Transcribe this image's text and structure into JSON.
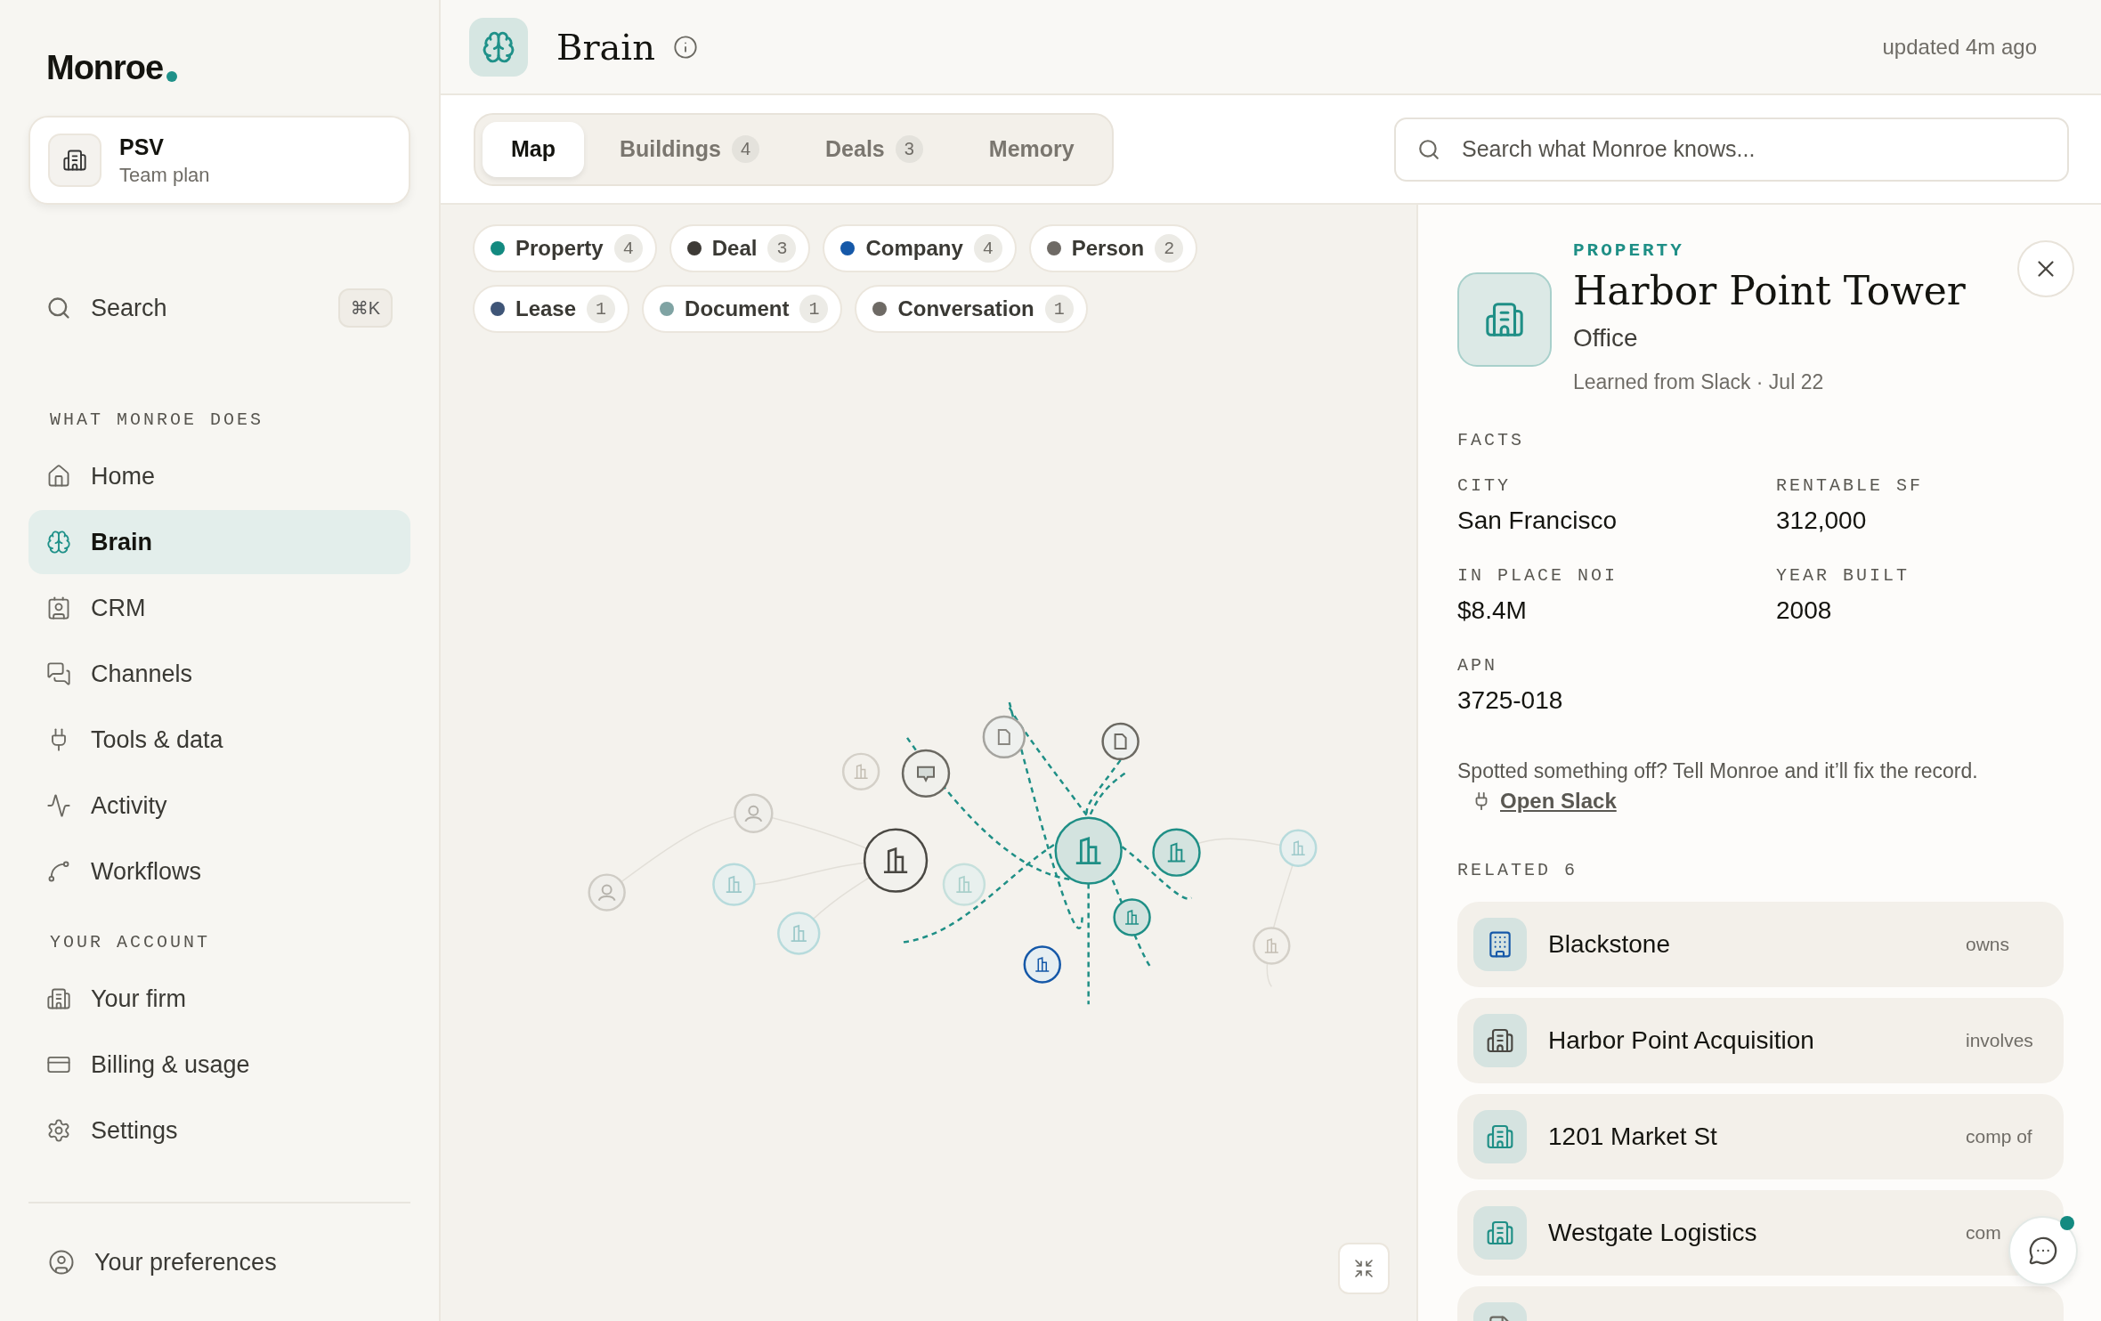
{
  "sidebar": {
    "logo": "Monroe",
    "workspace": {
      "name": "PSV",
      "plan": "Team plan"
    },
    "search": {
      "label": "Search",
      "shortcut": "⌘K"
    },
    "sections": [
      {
        "title": "WHAT MONROE DOES",
        "items": [
          {
            "label": "Home",
            "selected": false
          },
          {
            "label": "Brain",
            "selected": true
          },
          {
            "label": "CRM",
            "selected": false
          },
          {
            "label": "Channels",
            "selected": false
          },
          {
            "label": "Tools & data",
            "selected": false
          },
          {
            "label": "Activity",
            "selected": false
          },
          {
            "label": "Workflows",
            "selected": false
          }
        ]
      },
      {
        "title": "YOUR ACCOUNT",
        "items": [
          {
            "label": "Your firm",
            "selected": false
          },
          {
            "label": "Billing & usage",
            "selected": false
          },
          {
            "label": "Settings",
            "selected": false
          }
        ]
      }
    ],
    "footer": "Your preferences"
  },
  "header": {
    "title": "Brain",
    "updated": "updated 4m ago"
  },
  "tabs": [
    {
      "label": "Map",
      "selected": true
    },
    {
      "label": "Buildings",
      "count": "4",
      "selected": false
    },
    {
      "label": "Deals",
      "count": "3",
      "selected": false
    },
    {
      "label": "Memory",
      "selected": false
    }
  ],
  "search": {
    "placeholder": "Search what Monroe knows..."
  },
  "filters": [
    {
      "label": "Property",
      "count": "4",
      "color": "#138a80"
    },
    {
      "label": "Deal",
      "count": "3",
      "color": "#3d3a36"
    },
    {
      "label": "Company",
      "count": "4",
      "color": "#1558a8"
    },
    {
      "label": "Person",
      "count": "2",
      "color": "#6e6a65"
    },
    {
      "label": "Lease",
      "count": "1",
      "color": "#3f5577"
    },
    {
      "label": "Document",
      "count": "1",
      "color": "#7fa3a3"
    },
    {
      "label": "Conversation",
      "count": "1",
      "color": "#6e6a65"
    }
  ],
  "detail": {
    "type": "PROPERTY",
    "title": "Harbor Point Tower",
    "subtitle": "Office",
    "source": "Learned from Slack · Jul 22",
    "facts_title": "FACTS",
    "facts": [
      {
        "label": "CITY",
        "value": "San Francisco"
      },
      {
        "label": "RENTABLE SF",
        "value": "312,000"
      },
      {
        "label": "IN PLACE NOI",
        "value": "$8.4M"
      },
      {
        "label": "YEAR BUILT",
        "value": "2008"
      },
      {
        "label": "APN",
        "value": "3725-018"
      }
    ],
    "note": "Spotted something off? Tell Monroe and it’ll fix the record.",
    "link": "Open Slack",
    "related_title": "RELATED 6",
    "related": [
      {
        "kind": "company",
        "name": "Blackstone",
        "relation": "owns"
      },
      {
        "kind": "deal",
        "name": "Harbor Point Acquisition",
        "relation": "involves"
      },
      {
        "kind": "property",
        "name": "1201 Market St",
        "relation": "comp of"
      },
      {
        "kind": "property",
        "name": "Westgate Logistics",
        "relation": "com"
      },
      {
        "kind": "document"
      }
    ]
  },
  "chat": {
    "unread": true
  }
}
